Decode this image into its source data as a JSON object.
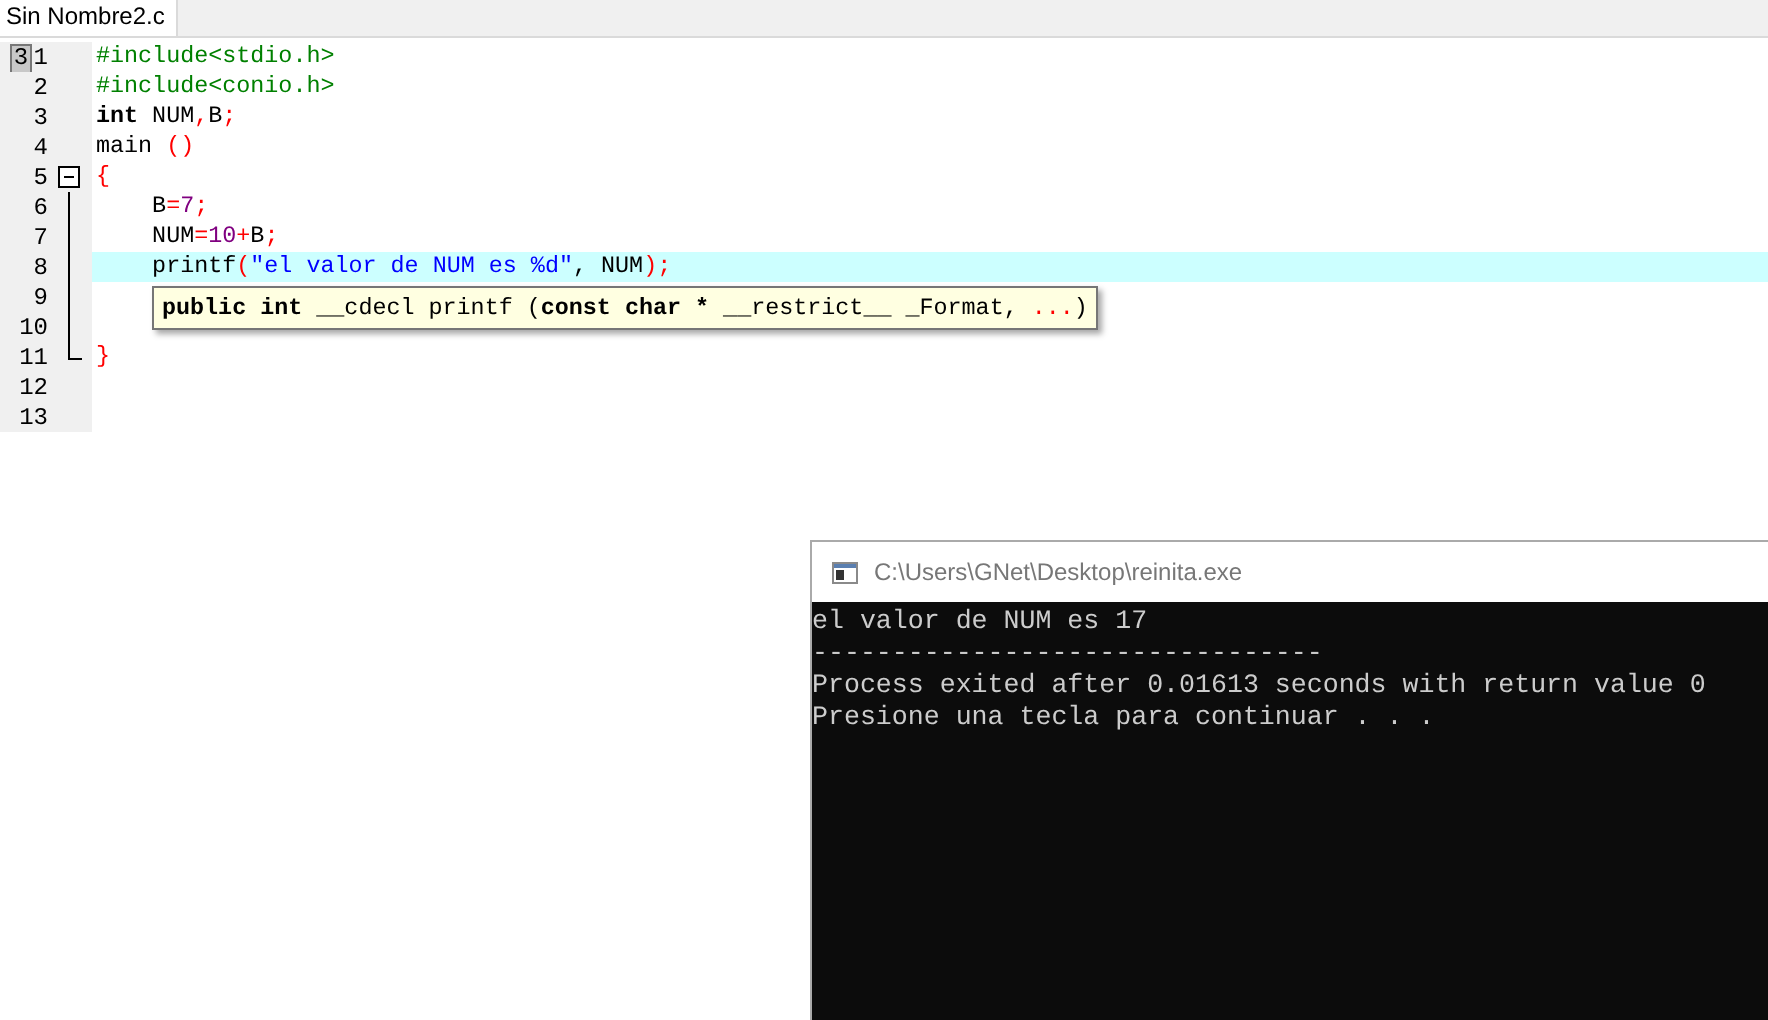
{
  "tabs": [
    {
      "label": "Sin Nombre2.c",
      "selected": true
    }
  ],
  "editor": {
    "lines": [
      {
        "number": "1",
        "marker": "3",
        "current": false,
        "tokens": [
          {
            "kind": "pre",
            "text": "#include<stdio.h>"
          }
        ]
      },
      {
        "number": "2",
        "current": false,
        "tokens": [
          {
            "kind": "pre",
            "text": "#include<conio.h>"
          }
        ]
      },
      {
        "number": "3",
        "current": false,
        "tokens": [
          {
            "kind": "kw",
            "text": "int"
          },
          {
            "kind": "plain",
            "text": " NUM"
          },
          {
            "kind": "op",
            "text": ","
          },
          {
            "kind": "plain",
            "text": "B"
          },
          {
            "kind": "op",
            "text": ";"
          }
        ]
      },
      {
        "number": "4",
        "current": false,
        "tokens": [
          {
            "kind": "plain",
            "text": "main "
          },
          {
            "kind": "op",
            "text": "()"
          }
        ]
      },
      {
        "number": "5",
        "current": false,
        "expanded": true,
        "tokens": [
          {
            "kind": "op",
            "text": "{"
          }
        ]
      },
      {
        "number": "6",
        "current": false,
        "tokens": [
          {
            "kind": "plain",
            "text": "    B"
          },
          {
            "kind": "op",
            "text": "="
          },
          {
            "kind": "num",
            "text": "7"
          },
          {
            "kind": "op",
            "text": ";"
          }
        ]
      },
      {
        "number": "7",
        "current": false,
        "tokens": [
          {
            "kind": "plain",
            "text": "    NUM"
          },
          {
            "kind": "op",
            "text": "="
          },
          {
            "kind": "num",
            "text": "10"
          },
          {
            "kind": "op",
            "text": "+"
          },
          {
            "kind": "plain",
            "text": "B"
          },
          {
            "kind": "op",
            "text": ";"
          }
        ]
      },
      {
        "number": "8",
        "current": true,
        "tokens": [
          {
            "kind": "plain",
            "text": "    printf"
          },
          {
            "kind": "op",
            "text": "("
          },
          {
            "kind": "str",
            "text": "\"el valor de NUM es %d\""
          },
          {
            "kind": "plain",
            "text": ", NUM"
          },
          {
            "kind": "op",
            "text": ");"
          }
        ]
      },
      {
        "number": "9",
        "current": false
      },
      {
        "number": "10",
        "current": false
      },
      {
        "number": "11",
        "current": false,
        "tokens": [
          {
            "kind": "op",
            "text": "}"
          }
        ]
      },
      {
        "number": "12",
        "current": false
      },
      {
        "number": "13",
        "current": false
      }
    ]
  },
  "tooltip": {
    "tokens": [
      {
        "kind": "bold",
        "text": "public int"
      },
      {
        "kind": "plain",
        "text": " __cdecl printf ("
      },
      {
        "kind": "bold",
        "text": "const char *"
      },
      {
        "kind": "plain",
        "text": " __restrict__ _Format, "
      },
      {
        "kind": "red",
        "text": "..."
      },
      {
        "kind": "plain",
        "text": ")"
      }
    ]
  },
  "console": {
    "title": "C:\\Users\\GNet\\Desktop\\reinita.exe",
    "lines": [
      "el valor de NUM es 17",
      "--------------------------------",
      "Process exited after 0.01613 seconds with return value 0",
      "Presione una tecla para continuar . . ."
    ]
  }
}
